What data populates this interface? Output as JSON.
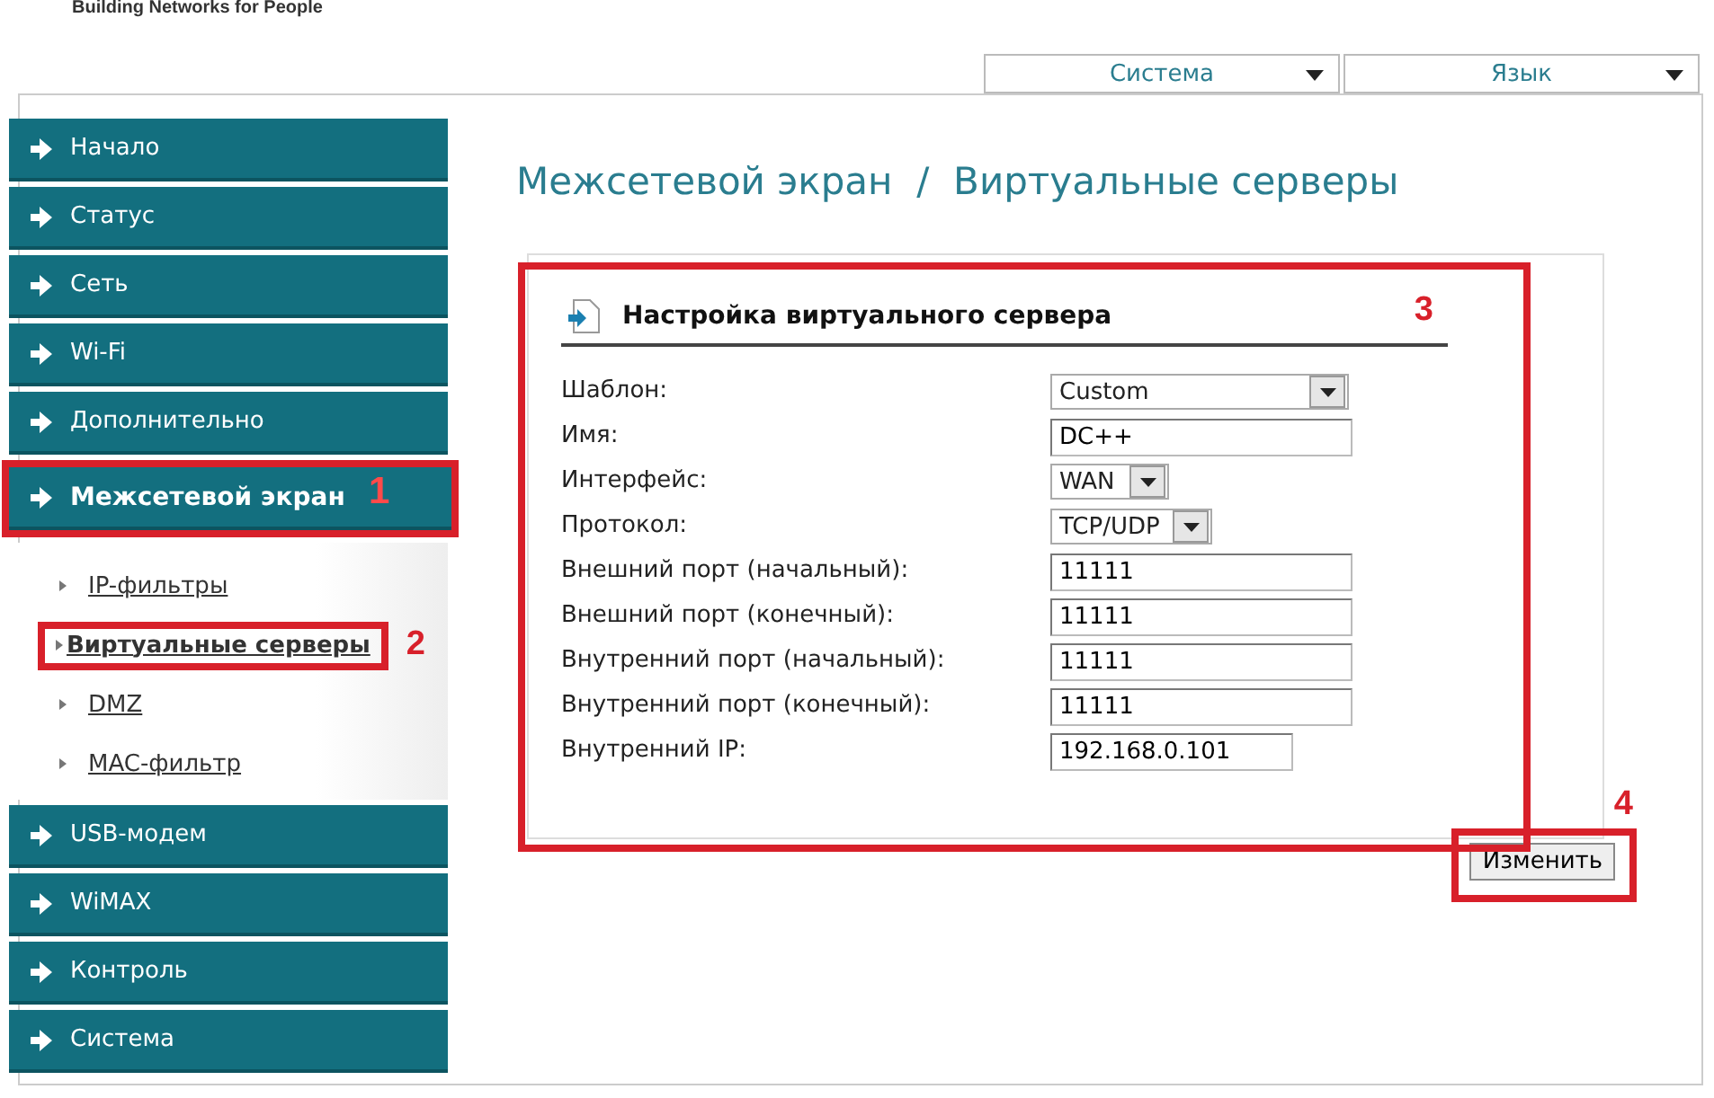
{
  "header": {
    "tagline": "Building Networks for People"
  },
  "top_menus": [
    {
      "label": "Система"
    },
    {
      "label": "Язык"
    }
  ],
  "sidebar": {
    "items": [
      {
        "label": "Начало",
        "selected": false
      },
      {
        "label": "Статус",
        "selected": false
      },
      {
        "label": "Сеть",
        "selected": false
      },
      {
        "label": "Wi-Fi",
        "selected": false
      },
      {
        "label": "Дополнительно",
        "selected": false
      },
      {
        "label": "Межсетевой экран",
        "selected": true,
        "callout": "1",
        "children": [
          {
            "label": "IP-фильтры",
            "selected": false
          },
          {
            "label": "Виртуальные серверы",
            "selected": true,
            "callout": "2"
          },
          {
            "label": "DMZ",
            "selected": false
          },
          {
            "label": "MAC-фильтр",
            "selected": false
          }
        ]
      },
      {
        "label": "USB-модем",
        "selected": false
      },
      {
        "label": "WiMAX",
        "selected": false
      },
      {
        "label": "Контроль",
        "selected": false
      },
      {
        "label": "Система",
        "selected": false
      }
    ]
  },
  "page_title": "Межсетевой экран  /  Виртуальные серверы",
  "form": {
    "title": "Настройка виртуального сервера",
    "callout": "3",
    "fields": [
      {
        "kind": "select",
        "label": "Шаблон:",
        "value": "Custom"
      },
      {
        "kind": "text",
        "label": "Имя:",
        "value": "DC++"
      },
      {
        "kind": "select",
        "label": "Интерфейс:",
        "value": "WAN"
      },
      {
        "kind": "select",
        "label": "Протокол:",
        "value": "TCP/UDP"
      },
      {
        "kind": "text",
        "label": "Внешний порт (начальный):",
        "value": "11111"
      },
      {
        "kind": "text",
        "label": "Внешний порт (конечный):",
        "value": "11111"
      },
      {
        "kind": "text",
        "label": "Внутренний порт (начальный):",
        "value": "11111"
      },
      {
        "kind": "text",
        "label": "Внутренний порт (конечный):",
        "value": "11111"
      },
      {
        "kind": "text",
        "label": "Внутренний IP:",
        "value": "192.168.0.101"
      }
    ]
  },
  "submit": {
    "label": "Изменить",
    "callout": "4"
  }
}
